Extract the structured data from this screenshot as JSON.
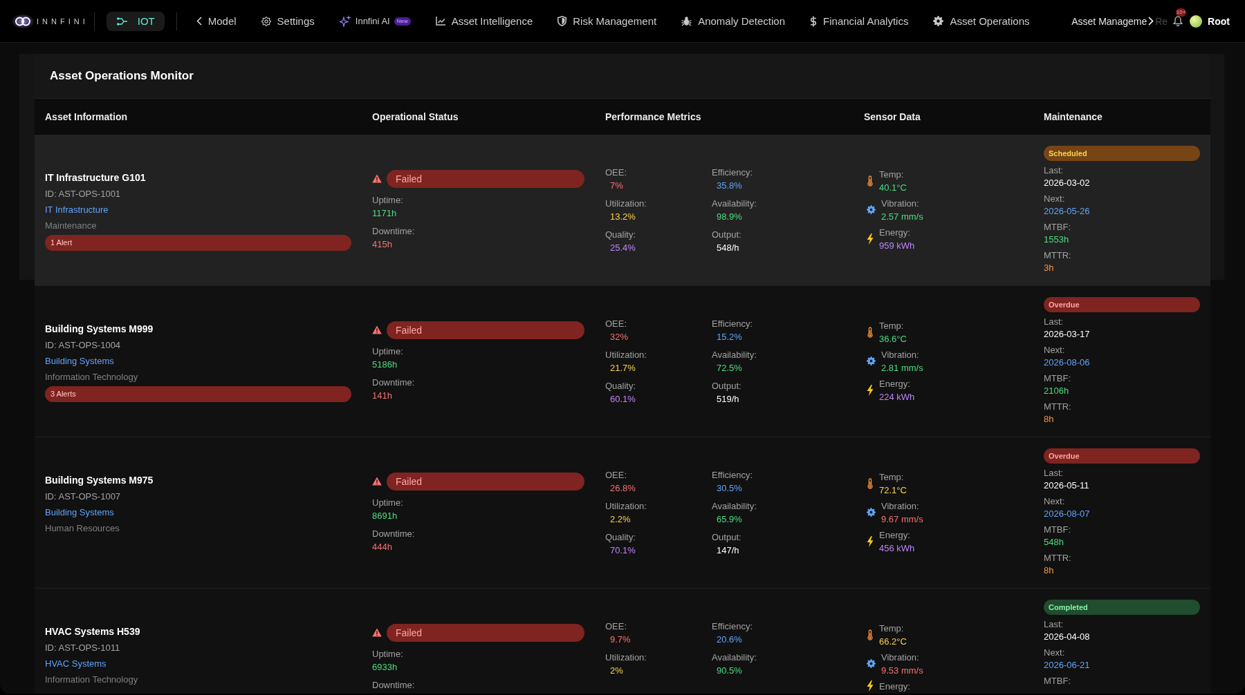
{
  "nav": {
    "logo": "INNFINI",
    "iot": "IOT",
    "back": "Model",
    "items": [
      {
        "kind": "settings",
        "label": "Settings"
      },
      {
        "kind": "ai",
        "label": "Innfini AI",
        "badge": "New"
      },
      {
        "kind": "intelligence",
        "label": "Asset Intelligence"
      },
      {
        "kind": "risk",
        "label": "Risk Management"
      },
      {
        "kind": "anomaly",
        "label": "Anomaly Detection"
      },
      {
        "kind": "financial",
        "label": "Financial Analytics"
      },
      {
        "kind": "operations",
        "label": "Asset Operations"
      }
    ],
    "overflow": [
      {
        "label": "Asset Manageme",
        "dimmed": false
      },
      {
        "label": "Re",
        "dimmed": true
      }
    ],
    "notifications": "10+",
    "user": "Root"
  },
  "panel": {
    "title": "Asset Operations Monitor"
  },
  "table": {
    "columns": [
      "Asset Information",
      "Operational Status",
      "Performance Metrics",
      "Sensor Data",
      "Maintenance"
    ],
    "rows": [
      {
        "selected": true,
        "asset": {
          "name": "IT Infrastructure G101",
          "id": "ID: AST-OPS-1001",
          "category": "IT Infrastructure",
          "department": "Maintenance",
          "alerts": "1 Alert"
        },
        "status": {
          "kind": "failed",
          "label": "Failed",
          "stats": [
            {
              "label": "Uptime:",
              "value": "1171h",
              "color": "#4ade80"
            },
            {
              "label": "Downtime:",
              "value": "415h",
              "color": "#f87171"
            }
          ]
        },
        "metrics": [
          {
            "label": "OEE:",
            "value": "7%",
            "color": "#f87171"
          },
          {
            "label": "Efficiency:",
            "value": "35.8%",
            "color": "#60a5fa"
          },
          {
            "label": "Utilization:",
            "value": "13.2%",
            "color": "#fcd34d"
          },
          {
            "label": "Availability:",
            "value": "98.9%",
            "color": "#4ade80"
          },
          {
            "label": "Quality:",
            "value": "25.4%",
            "color": "#c084fc"
          },
          {
            "label": "Output:",
            "value": "548/h",
            "color": "#ffffff"
          }
        ],
        "sensors": [
          {
            "kind": "temperature",
            "label": "Temp:",
            "value": "40.1°C",
            "color": "#4ade80"
          },
          {
            "kind": "vibration",
            "label": "Vibration:",
            "value": "2.57 mm/s",
            "color": "#4ade80"
          },
          {
            "kind": "energy",
            "label": "Energy:",
            "value": "959 kWh",
            "color": "#c084fc"
          }
        ],
        "maintenance": {
          "kind": "scheduled",
          "label": "Scheduled",
          "fields": [
            {
              "label": "Last:",
              "value": "2026-03-02",
              "color": "#ffffff"
            },
            {
              "label": "Next:",
              "value": "2026-05-26",
              "color": "#60a5fa"
            },
            {
              "label": "MTBF:",
              "value": "1553h",
              "color": "#4ade80"
            },
            {
              "label": "MTTR:",
              "value": "3h",
              "color": "#fb923c"
            }
          ]
        }
      },
      {
        "selected": false,
        "asset": {
          "name": "Building Systems M999",
          "id": "ID: AST-OPS-1004",
          "category": "Building Systems",
          "department": "Information Technology",
          "alerts": "3 Alerts"
        },
        "status": {
          "kind": "failed",
          "label": "Failed",
          "stats": [
            {
              "label": "Uptime:",
              "value": "5186h",
              "color": "#4ade80"
            },
            {
              "label": "Downtime:",
              "value": "141h",
              "color": "#f87171"
            }
          ]
        },
        "metrics": [
          {
            "label": "OEE:",
            "value": "32%",
            "color": "#f87171"
          },
          {
            "label": "Efficiency:",
            "value": "15.2%",
            "color": "#60a5fa"
          },
          {
            "label": "Utilization:",
            "value": "21.7%",
            "color": "#fcd34d"
          },
          {
            "label": "Availability:",
            "value": "72.5%",
            "color": "#4ade80"
          },
          {
            "label": "Quality:",
            "value": "60.1%",
            "color": "#c084fc"
          },
          {
            "label": "Output:",
            "value": "519/h",
            "color": "#ffffff"
          }
        ],
        "sensors": [
          {
            "kind": "temperature",
            "label": "Temp:",
            "value": "36.6°C",
            "color": "#4ade80"
          },
          {
            "kind": "vibration",
            "label": "Vibration:",
            "value": "2.81 mm/s",
            "color": "#4ade80"
          },
          {
            "kind": "energy",
            "label": "Energy:",
            "value": "224 kWh",
            "color": "#c084fc"
          }
        ],
        "maintenance": {
          "kind": "overdue",
          "label": "Overdue",
          "fields": [
            {
              "label": "Last:",
              "value": "2026-03-17",
              "color": "#ffffff"
            },
            {
              "label": "Next:",
              "value": "2026-08-06",
              "color": "#60a5fa"
            },
            {
              "label": "MTBF:",
              "value": "2106h",
              "color": "#4ade80"
            },
            {
              "label": "MTTR:",
              "value": "8h",
              "color": "#fb923c"
            }
          ]
        }
      },
      {
        "selected": false,
        "asset": {
          "name": "Building Systems M975",
          "id": "ID: AST-OPS-1007",
          "category": "Building Systems",
          "department": "Human Resources"
        },
        "status": {
          "kind": "failed",
          "label": "Failed",
          "stats": [
            {
              "label": "Uptime:",
              "value": "8691h",
              "color": "#4ade80"
            },
            {
              "label": "Downtime:",
              "value": "444h",
              "color": "#f87171"
            }
          ]
        },
        "metrics": [
          {
            "label": "OEE:",
            "value": "26.8%",
            "color": "#f87171"
          },
          {
            "label": "Efficiency:",
            "value": "30.5%",
            "color": "#60a5fa"
          },
          {
            "label": "Utilization:",
            "value": "2.2%",
            "color": "#fcd34d"
          },
          {
            "label": "Availability:",
            "value": "65.9%",
            "color": "#4ade80"
          },
          {
            "label": "Quality:",
            "value": "70.1%",
            "color": "#c084fc"
          },
          {
            "label": "Output:",
            "value": "147/h",
            "color": "#ffffff"
          }
        ],
        "sensors": [
          {
            "kind": "temperature",
            "label": "Temp:",
            "value": "72.1°C",
            "color": "#fcd34d"
          },
          {
            "kind": "vibration",
            "label": "Vibration:",
            "value": "9.67 mm/s",
            "color": "#f87171"
          },
          {
            "kind": "energy",
            "label": "Energy:",
            "value": "456 kWh",
            "color": "#c084fc"
          }
        ],
        "maintenance": {
          "kind": "overdue",
          "label": "Overdue",
          "fields": [
            {
              "label": "Last:",
              "value": "2026-05-11",
              "color": "#ffffff"
            },
            {
              "label": "Next:",
              "value": "2026-08-07",
              "color": "#60a5fa"
            },
            {
              "label": "MTBF:",
              "value": "548h",
              "color": "#4ade80"
            },
            {
              "label": "MTTR:",
              "value": "8h",
              "color": "#fb923c"
            }
          ]
        }
      },
      {
        "selected": false,
        "asset": {
          "name": "HVAC Systems H539",
          "id": "ID: AST-OPS-1011",
          "category": "HVAC Systems",
          "department": "Information Technology"
        },
        "status": {
          "kind": "failed",
          "label": "Failed",
          "stats": [
            {
              "label": "Uptime:",
              "value": "6933h",
              "color": "#4ade80"
            },
            {
              "label": "Downtime:"
            }
          ]
        },
        "metrics": [
          {
            "label": "OEE:",
            "value": "9.7%",
            "color": "#f87171"
          },
          {
            "label": "Efficiency:",
            "value": "20.6%",
            "color": "#60a5fa"
          },
          {
            "label": "Utilization:",
            "value": "2%",
            "color": "#fcd34d"
          },
          {
            "label": "Availability:",
            "value": "90.5%",
            "color": "#4ade80"
          }
        ],
        "sensors": [
          {
            "kind": "temperature",
            "label": "Temp:",
            "value": "66.2°C",
            "color": "#fcd34d"
          },
          {
            "kind": "vibration",
            "label": "Vibration:",
            "value": "9.53 mm/s",
            "color": "#f87171"
          },
          {
            "kind": "energy",
            "label": "Energy:"
          }
        ],
        "maintenance": {
          "kind": "completed",
          "label": "Completed",
          "fields": [
            {
              "label": "Last:",
              "value": "2026-04-08",
              "color": "#ffffff"
            },
            {
              "label": "Next:",
              "value": "2026-06-21",
              "color": "#60a5fa"
            },
            {
              "label": "MTBF:"
            }
          ]
        }
      }
    ]
  }
}
